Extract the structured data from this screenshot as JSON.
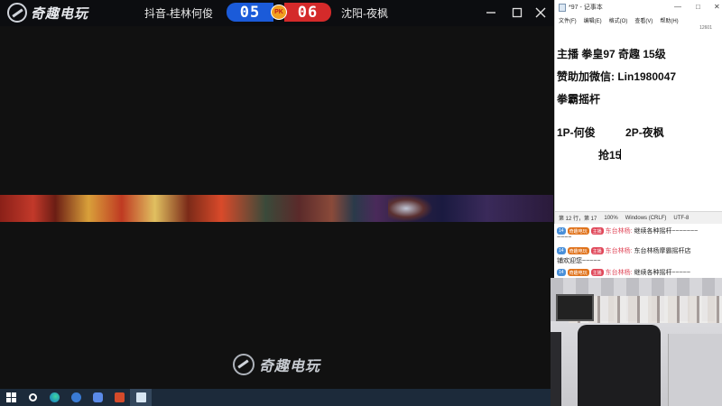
{
  "main_window": {
    "brand_name": "奇趣电玩",
    "player1": "抖音-桂林何俊",
    "player2": "沈阳-夜枫",
    "score_left": "05",
    "score_right": "06",
    "pk_label": "PK",
    "bottom_logo_text": "奇趣电玩",
    "colors": {
      "score_left": "#1b5bd9",
      "score_right": "#d42a2a",
      "pk_badge": "#f0a020"
    }
  },
  "notepad": {
    "title": "*97 - 记事本",
    "corner_text": "12601",
    "menu": [
      "文件(F)",
      "编辑(E)",
      "格式(O)",
      "查看(V)",
      "帮助(H)"
    ],
    "lines": [
      "主播 拳皇97 奇趣 15级",
      "赞助加微信: Lin1980047",
      "拳霸摇杆",
      "1P-何俊          2P-夜枫",
      "抢15"
    ],
    "status": {
      "position": "第 12 行，第 17",
      "zoom": "100%",
      "line_ending": "Windows (CRLF)",
      "encoding": "UTF-8"
    }
  },
  "chat": {
    "badge_level": "14",
    "badge_fan": "奇趣电玩",
    "badge_host": "主播",
    "messages": [
      {
        "user": "东台林杨:",
        "text": "继续各种摇杆~~~~~~~",
        "continuation": "~~~~"
      },
      {
        "user": "东台林杨:",
        "text": "东台林杨摩霸摇杆店",
        "continuation": "铺欢迎您~~~~~"
      },
      {
        "user": "东台林杨:",
        "text": "继续各种摇杆~~~~~"
      }
    ]
  },
  "taskbar": {
    "icons": [
      "start-icon",
      "search-icon",
      "edge-icon",
      "app-icon",
      "app-icon",
      "app-icon",
      "notepad-icon"
    ]
  }
}
